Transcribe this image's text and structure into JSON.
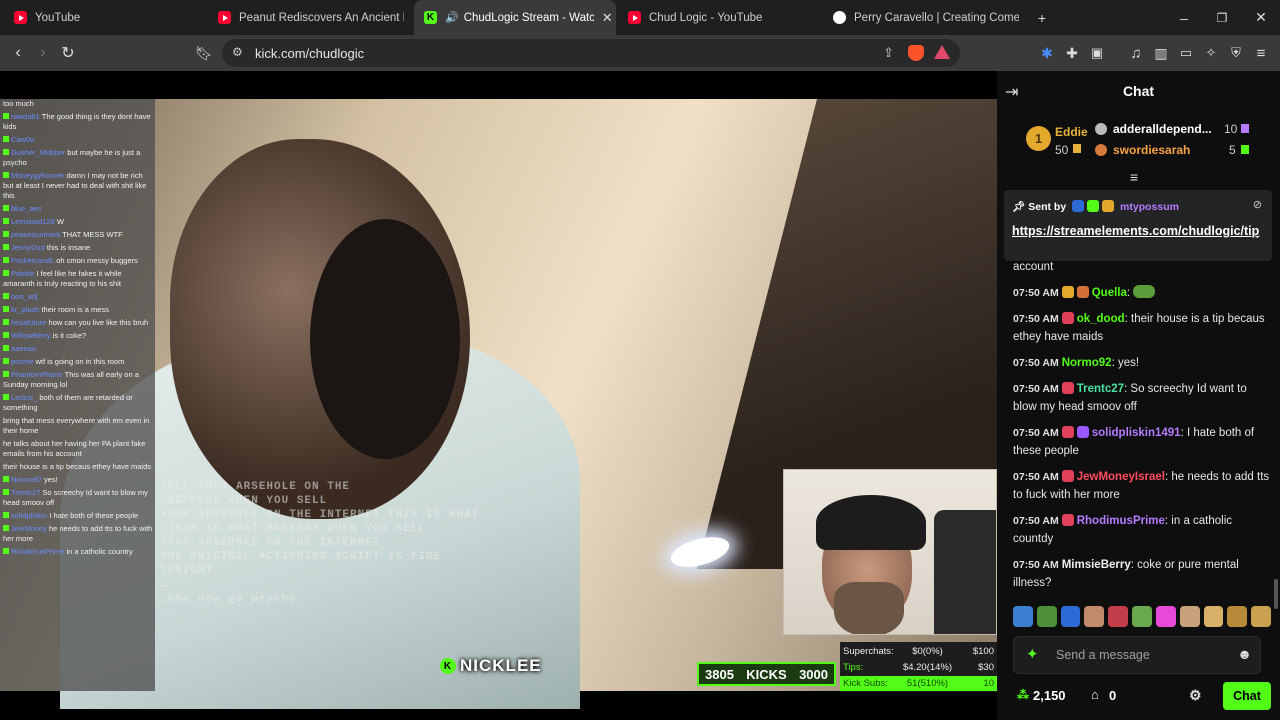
{
  "tabs": [
    {
      "title": "YouTube",
      "icon": "youtube-icon",
      "active": false
    },
    {
      "title": "Peanut Rediscovers An Ancient Lost T",
      "icon": "youtube-icon",
      "active": false
    },
    {
      "title": "ChudLogic Stream - Watch Li",
      "icon": "kick-icon",
      "active": true
    },
    {
      "title": "Chud Logic - YouTube",
      "icon": "youtube-icon",
      "active": false
    },
    {
      "title": "Perry Caravello | Creating Comedy, V",
      "icon": "patreon-icon",
      "active": false
    }
  ],
  "address_bar": {
    "url": "kick.com/chudlogic"
  },
  "window_controls": {
    "minimize": "–",
    "restore": "❐",
    "close": "✕",
    "new_tab": "+"
  },
  "video": {
    "overlay_chat": [
      {
        "user": "",
        "text": "too much"
      },
      {
        "user": "rawdab1",
        "text": "The good thing is they dont have kids"
      },
      {
        "user": "Caw0u",
        "text": ""
      },
      {
        "user": "Gusher_Mobber",
        "text": "but maybe he is just a psycho"
      },
      {
        "user": "Moneygyhoover",
        "text": "damn I may not be rich but at least I never had to deal with shit like this"
      },
      {
        "user": "blue_aes",
        "text": ""
      },
      {
        "user": "Lemonad128",
        "text": "W"
      },
      {
        "user": "peacesunmark",
        "text": "THAT MESS WTF"
      },
      {
        "user": "JennyDud",
        "text": "this is insane"
      },
      {
        "user": "PocketsandL",
        "text": "oh cmon messy buggers"
      },
      {
        "user": "Pebble",
        "text": "I feel like he fakes it while amaranth is truly reacting to his shit"
      },
      {
        "user": "ooo_adj",
        "text": ""
      },
      {
        "user": "kr_plash",
        "text": "their room is a mess"
      },
      {
        "user": "hesafuture",
        "text": "how can you live like this bruh"
      },
      {
        "user": "WillowBerry",
        "text": "is it coke?"
      },
      {
        "user": "aaeeao",
        "text": ""
      },
      {
        "user": "pocme",
        "text": "wtf is going on in this room"
      },
      {
        "user": "PhantomPhone",
        "text": "This was all early on a Sunday morning lol"
      },
      {
        "user": "Lectric_",
        "text": "both of them are retarded or something"
      },
      {
        "user": "",
        "text": "bring that mess everywhere with em even in their home"
      },
      {
        "user": "",
        "text": "he talks about her having her PA plant fake emails from his account"
      },
      {
        "user": "",
        "text": "their house is a tip becaus ethey have maids"
      },
      {
        "user": "Normo92",
        "text": "yes!"
      },
      {
        "user": "Trentc27",
        "text": "So screechy Id want to blow my head smoov off"
      },
      {
        "user": "solidpliskin",
        "text": "I hate both of these people"
      },
      {
        "user": "JewMoney",
        "text": "he needs to add tts to fuck with her more"
      },
      {
        "user": "RhodimusPrime",
        "text": "in a catholic country"
      }
    ],
    "ghost_text": [
      "TELL YOUR ARSEHOLE ON THE",
      "…HAPPENS WHEN YOU SELL",
      "YOUR ARSEHOLE ON THE INTERNET THIS IS WHAT",
      "…THIS IS WHAT HAPPENS WHEN YOU SELL",
      "YOUR ARSEHOLE ON THE INTERNET",
      "THE ORIGINAL ACTIONING SCRIPT IS FIRE",
      "TONIGHT",
      "…",
      "…one now go psyche"
    ],
    "watermark": "NICKLEE",
    "kicks": {
      "left": "3805",
      "label": "KICKS",
      "right": "3000"
    },
    "stats": [
      {
        "label": "Superchats:",
        "value": "$0(0%)",
        "goal": "$100",
        "highlight": false
      },
      {
        "label": "Tips:",
        "value": "$4.20(14%)",
        "goal": "$30",
        "highlight": false
      },
      {
        "label": "Kick Subs:",
        "value": "51(510%)",
        "goal": "10",
        "highlight": true
      }
    ]
  },
  "chat": {
    "title": "Chat",
    "leaderboard": [
      {
        "rank": "1",
        "name": "Eddie",
        "amount": "50",
        "color": "#e8b23a"
      },
      {
        "rank": "",
        "name": "adderalldepend...",
        "amount": "10",
        "color": "#ffffff"
      },
      {
        "rank": "",
        "name": "swordiesarah",
        "amount": "5",
        "color": "#f7a247"
      }
    ],
    "pinned": {
      "sent_by_label": "Sent by",
      "user": "mtypossum",
      "link": "https://streamelements.com/chudlogic/tip"
    },
    "partial_line": "account",
    "messages": [
      {
        "time": "07:50 AM",
        "user": "Quella",
        "color": "#53fc18",
        "text": "",
        "badges": [
          "#e3a92c",
          "#d4713a"
        ]
      },
      {
        "time": "07:50 AM",
        "user": "ok_dood",
        "color": "#53fc18",
        "text": "their house is a tip becaus ethey have maids",
        "badges": [
          "#e0405a"
        ]
      },
      {
        "time": "07:50 AM",
        "user": "Normo92",
        "color": "#53fc18",
        "text": "yes!",
        "badges": []
      },
      {
        "time": "07:50 AM",
        "user": "Trentc27",
        "color": "#4be3a0",
        "text": "So screechy Id want to blow my head smoov off",
        "badges": [
          "#e0405a"
        ]
      },
      {
        "time": "07:50 AM",
        "user": "solidpliskin1491",
        "color": "#b67cff",
        "text": "I hate both of these people",
        "badges": [
          "#e0405a",
          "#9b59ff"
        ]
      },
      {
        "time": "07:50 AM",
        "user": "JewMoneyIsrael",
        "color": "#ff4d5e",
        "text": "he needs to add tts to fuck with her more",
        "badges": [
          "#e0405a"
        ]
      },
      {
        "time": "07:50 AM",
        "user": "RhodimusPrime",
        "color": "#b67cff",
        "text": "in a catholic countdy",
        "badges": [
          "#e0405a"
        ]
      },
      {
        "time": "07:50 AM",
        "user": "MimsieBerry",
        "color": "#f0f0f0",
        "text": "coke or pure mental illness?",
        "badges": []
      }
    ],
    "emote_colors": [
      "#3a7fd0",
      "#4e8f3a",
      "#2d6ad6",
      "#c08a6b",
      "#c43d4a",
      "#6aa84f",
      "#e84ad8",
      "#c8a27a",
      "#d8b06a",
      "#b78a3a",
      "#c9a04f"
    ],
    "input_placeholder": "Send a message",
    "points": "2,150",
    "bag_count": "0",
    "send_label": "Chat"
  }
}
